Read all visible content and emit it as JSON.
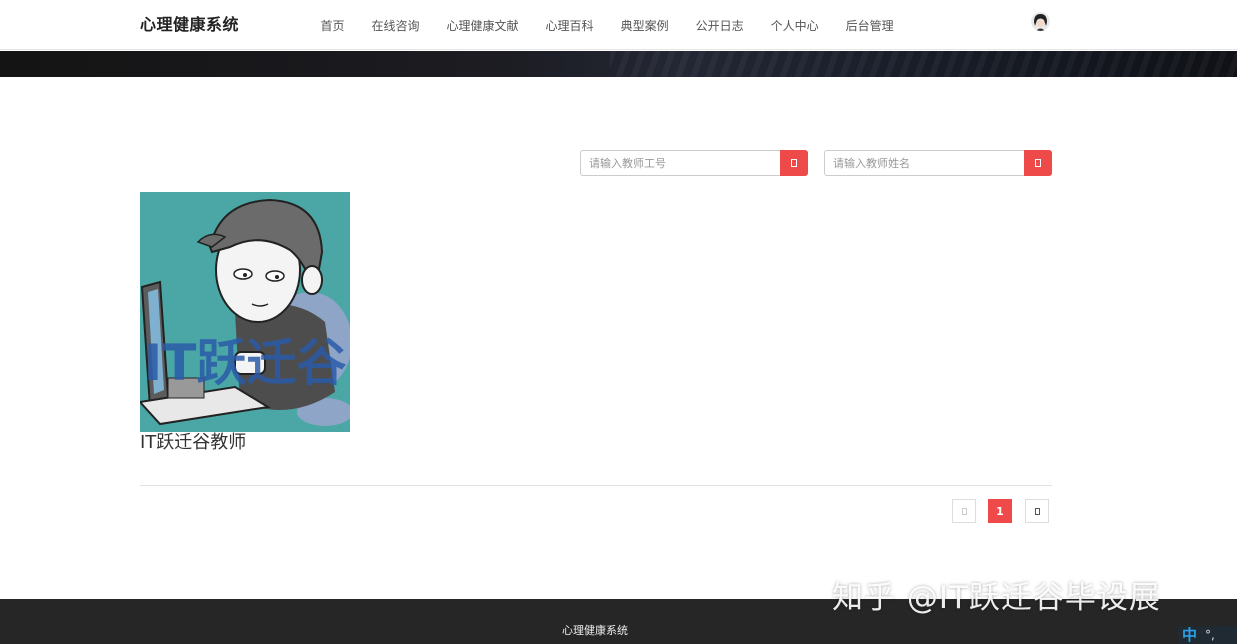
{
  "header": {
    "brand": "心理健康系统",
    "nav": [
      "首页",
      "在线咨询",
      "心理健康文献",
      "心理百科",
      "典型案例",
      "公开日志",
      "个人中心",
      "后台管理"
    ]
  },
  "search": {
    "teacher_id_placeholder": "请输入教师工号",
    "teacher_name_placeholder": "请输入教师姓名"
  },
  "teachers": [
    {
      "name": "IT跃迁谷教师",
      "image_text": "IT跃迁谷"
    }
  ],
  "pagination": {
    "current": "1"
  },
  "footer": {
    "text": "心理健康系统"
  },
  "ime": {
    "mode": "中",
    "punct": "°,"
  },
  "watermark": "知乎 @IT跃迁谷毕设展",
  "colors": {
    "accent": "#ef4a4a",
    "footer_bg": "#262626"
  }
}
